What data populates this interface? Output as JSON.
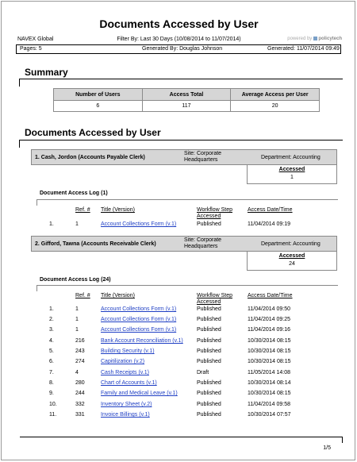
{
  "report": {
    "title": "Documents Accessed by User",
    "organization": "NAVEX Global",
    "filter": "Filter By: Last 30 Days (10/08/2014 to 11/07/2014)",
    "brand_prefix": "powered by",
    "brand_name": "policytech",
    "pages": "Pages: 5",
    "generated_by": "Generated By: Douglas Johnson",
    "generated_at": "Generated: 11/07/2014 09:49",
    "page_number": "1/5"
  },
  "summary": {
    "title": "Summary",
    "headers": [
      "Number of Users",
      "Access Total",
      "Average Access per User"
    ],
    "values": [
      "6",
      "117",
      "20"
    ]
  },
  "section": {
    "title": "Documents Accessed by User",
    "col_ref": "Ref. #",
    "col_title": "Title (Version)",
    "col_step": "Workflow Step Accessed",
    "col_date": "Access Date/Time",
    "accessed_label": "Accessed"
  },
  "users": [
    {
      "name": "1. Cash, Jordon (Accounts Payable Clerk)",
      "site": "Site: Corporate Headquarters",
      "department": "Department: Accounting",
      "accessed": "1",
      "log_title": "Document Access Log (1)",
      "rows": [
        {
          "num": "1.",
          "ref": "1",
          "title": "Account Collections Form (v.1)",
          "step": "Published",
          "date": "11/04/2014 09:19"
        }
      ]
    },
    {
      "name": "2. Gifford, Tawna (Accounts Receivable Clerk)",
      "site": "Site: Corporate Headquarters",
      "department": "Department: Accounting",
      "accessed": "24",
      "log_title": "Document Access Log (24)",
      "rows": [
        {
          "num": "1.",
          "ref": "1",
          "title": "Account Collections Form (v.1)",
          "step": "Published",
          "date": "11/04/2014 09:50"
        },
        {
          "num": "2.",
          "ref": "1",
          "title": "Account Collections Form (v.1)",
          "step": "Published",
          "date": "11/04/2014 09:25"
        },
        {
          "num": "3.",
          "ref": "1",
          "title": "Account Collections Form (v.1)",
          "step": "Published",
          "date": "11/04/2014 09:16"
        },
        {
          "num": "4.",
          "ref": "216",
          "title": "Bank Account Reconciliation (v.1)",
          "step": "Published",
          "date": "10/30/2014 08:15"
        },
        {
          "num": "5.",
          "ref": "243",
          "title": "Building Security (v.1)",
          "step": "Published",
          "date": "10/30/2014 08:15"
        },
        {
          "num": "6.",
          "ref": "274",
          "title": "Capitilization (v.2)",
          "step": "Published",
          "date": "10/30/2014 08:15"
        },
        {
          "num": "7.",
          "ref": "4",
          "title": "Cash Receipts (v.1)",
          "step": "Draft",
          "date": "11/05/2014 14:08"
        },
        {
          "num": "8.",
          "ref": "280",
          "title": "Chart of Accounts (v.1)",
          "step": "Published",
          "date": "10/30/2014 08:14"
        },
        {
          "num": "9.",
          "ref": "244",
          "title": "Family and Medical Leave (v.1)",
          "step": "Published",
          "date": "10/30/2014 08:15"
        },
        {
          "num": "10.",
          "ref": "332",
          "title": "Inventory Sheet (v.2)",
          "step": "Published",
          "date": "11/04/2014 09:58"
        },
        {
          "num": "11.",
          "ref": "331",
          "title": "Invoice Billings (v.1)",
          "step": "Published",
          "date": "10/30/2014 07:57"
        }
      ]
    }
  ]
}
